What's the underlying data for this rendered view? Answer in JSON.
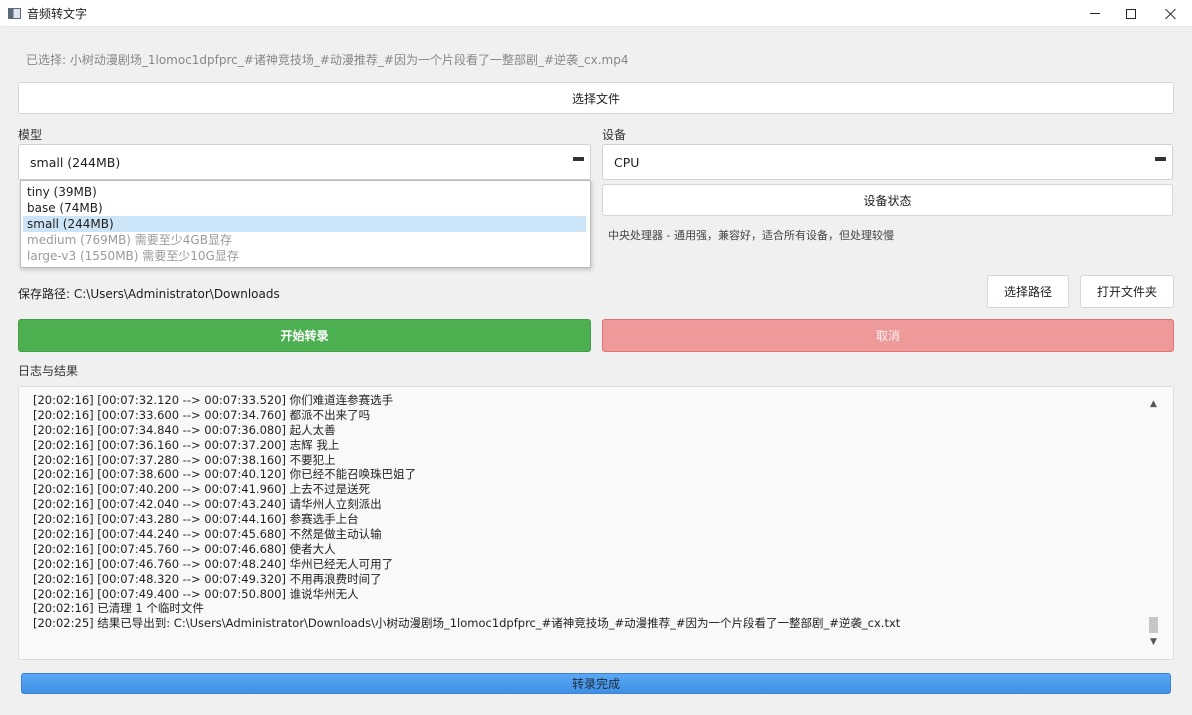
{
  "window": {
    "title": "音频转文字"
  },
  "selected_file_text": "已选择: 小树动漫剧场_1lomoc1dpfprc_#诸神竞技场_#动漫推荐_#因为一个片段看了一整部剧_#逆袭_cx.mp4",
  "buttons": {
    "choose_file": "选择文件",
    "device_status": "设备状态",
    "choose_path": "选择路径",
    "open_folder": "打开文件夹",
    "start": "开始转录",
    "cancel": "取消"
  },
  "model": {
    "label": "模型",
    "selected": "small (244MB)",
    "options": [
      {
        "text": "tiny (39MB)",
        "state": "normal"
      },
      {
        "text": "base (74MB)",
        "state": "normal"
      },
      {
        "text": "small (244MB)",
        "state": "selected"
      },
      {
        "text": "medium (769MB) 需要至少4GB显存",
        "state": "disabled"
      },
      {
        "text": "large-v3 (1550MB) 需要至少10G显存",
        "state": "disabled"
      }
    ]
  },
  "device": {
    "label": "设备",
    "selected": "CPU",
    "description": "中央处理器 - 通用强，兼容好，适合所有设备，但处理较慢"
  },
  "save_path_text": "保存路径: C:\\Users\\Administrator\\Downloads",
  "log": {
    "label": "日志与结果",
    "lines": [
      "[20:02:16] [00:07:32.120 --> 00:07:33.520] 你们难道连参赛选手",
      "[20:02:16] [00:07:33.600 --> 00:07:34.760] 都派不出来了吗",
      "[20:02:16] [00:07:34.840 --> 00:07:36.080] 起人太善",
      "[20:02:16] [00:07:36.160 --> 00:07:37.200] 志辉 我上",
      "[20:02:16] [00:07:37.280 --> 00:07:38.160] 不要犯上",
      "[20:02:16] [00:07:38.600 --> 00:07:40.120] 你已经不能召唤珠巴姐了",
      "[20:02:16] [00:07:40.200 --> 00:07:41.960] 上去不过是送死",
      "[20:02:16] [00:07:42.040 --> 00:07:43.240] 请华州人立刻派出",
      "[20:02:16] [00:07:43.280 --> 00:07:44.160] 参赛选手上台",
      "[20:02:16] [00:07:44.240 --> 00:07:45.680] 不然是做主动认输",
      "[20:02:16] [00:07:45.760 --> 00:07:46.680] 使者大人",
      "[20:02:16] [00:07:46.760 --> 00:07:48.240] 华州已经无人可用了",
      "[20:02:16] [00:07:48.320 --> 00:07:49.320] 不用再浪费时间了",
      "[20:02:16] [00:07:49.400 --> 00:07:50.800] 谁说华州无人",
      "[20:02:16] 已清理 1 个临时文件",
      "[20:02:25] 结果已导出到: C:\\Users\\Administrator\\Downloads\\小树动漫剧场_1lomoc1dpfprc_#诸神竞技场_#动漫推荐_#因为一个片段看了一整部剧_#逆袭_cx.txt"
    ]
  },
  "progress": {
    "text": "转录完成",
    "percent": 100
  },
  "colors": {
    "start_button": "#4caf50",
    "cancel_button": "#ef9a9a",
    "progress_bar": "#4a9af0",
    "dropdown_selected": "#cce4f7"
  },
  "icons": {
    "app": "app-window-icon",
    "minimize": "minimize-icon",
    "maximize": "maximize-icon",
    "close": "close-icon",
    "combo_arrow": "dropdown-arrow-icon",
    "scroll_up": "scroll-up-icon",
    "scroll_down": "scroll-down-icon"
  }
}
